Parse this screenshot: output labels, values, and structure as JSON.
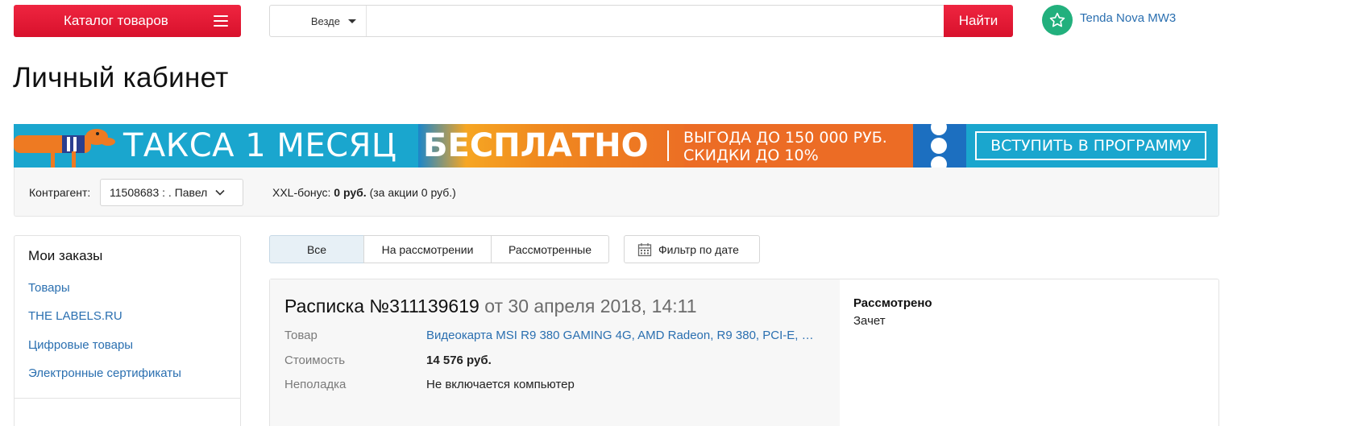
{
  "header": {
    "catalog_label": "Каталог товаров",
    "search": {
      "scope": "Везде",
      "placeholder": "",
      "value": "",
      "button_label": "Найти"
    },
    "user_name": "Tenda Nova MW3"
  },
  "page_title": "Личный кабинет",
  "banner": {
    "main_text": "ТАКСА 1 МЕСЯЦ",
    "free_text": "БЕСПЛАТНО",
    "benefit_line1": "ВЫГОДА ДО 150 000 РУБ.",
    "benefit_line2": "СКИДКИ ДО 10%",
    "cta_label": "ВСТУПИТЬ В ПРОГРАММУ",
    "colors": {
      "background": "#1aa6ce",
      "accent": "#ec6c25"
    }
  },
  "contragent": {
    "label": "Контрагент:",
    "selected": "11508683 : . Павел",
    "bonus_label": "XXL-бонус:",
    "bonus_value": "0 руб.",
    "bonus_note": "(за акции 0 руб.)"
  },
  "sidebar": {
    "title": "Мои заказы",
    "items": [
      {
        "label": "Товары"
      },
      {
        "label": "THE LABELS.RU"
      },
      {
        "label": "Цифровые товары"
      },
      {
        "label": "Электронные сертификаты"
      }
    ]
  },
  "tabs": [
    {
      "label": "Все",
      "active": true
    },
    {
      "label": "На рассмотрении",
      "active": false
    },
    {
      "label": "Рассмотренные",
      "active": false
    }
  ],
  "date_filter_label": "Фильтр по дате",
  "order": {
    "title": "Расписка №311139619",
    "date": "от 30 апреля 2018, 14:11",
    "rows": [
      {
        "label": "Товар",
        "value": "Видеокарта MSI R9 380 GAMING 4G, AMD Radeon, R9 380, PCI-E, …"
      },
      {
        "label": "Стоимость",
        "value": "14 576 руб."
      },
      {
        "label": "Неполадка",
        "value": "Не включается компьютер"
      }
    ],
    "status": "Рассмотрено",
    "status_detail": "Зачет"
  },
  "colors": {
    "brand_red": "#e31e3a",
    "link_blue": "#2a6fb0",
    "avatar_green": "#22b07d"
  }
}
